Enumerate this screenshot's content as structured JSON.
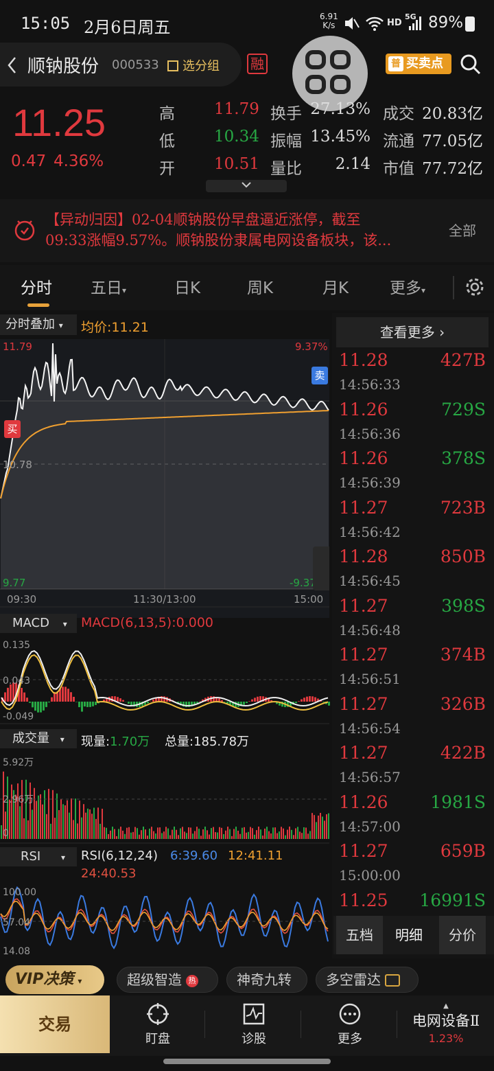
{
  "status": {
    "time": "15:05",
    "date": "2月6日周五",
    "net_speed": "6.91",
    "net_unit": "K/s",
    "hd": "HD",
    "sig": "5G",
    "battery": "89%"
  },
  "header": {
    "title": "顺钠股份",
    "code": "000533",
    "group_label": "选分组",
    "rong": "融",
    "buy_sell": "买卖点"
  },
  "quote": {
    "price": "11.25",
    "change": "0.47",
    "pct": "4.36%",
    "rows": [
      {
        "k1": "高",
        "v1": "11.79",
        "k2": "换手",
        "v2": "27.13%",
        "k3": "成交",
        "v3": "20.83亿"
      },
      {
        "k1": "低",
        "v1": "10.34",
        "k2": "振幅",
        "v2": "13.45%",
        "k3": "流通",
        "v3": "77.05亿"
      },
      {
        "k1": "开",
        "v1": "10.51",
        "k2": "量比",
        "v2": "2.14",
        "k3": "市值",
        "v3": "77.72亿"
      }
    ]
  },
  "news": {
    "line1": "【异动归因】02-04顺钠股份早盘逼近涨停，截至",
    "line2": "09:33涨幅9.57%。顺钠股份隶属电网设备板块，该...",
    "all": "全部"
  },
  "tabs": [
    "分时",
    "五日",
    "日K",
    "周K",
    "月K",
    "更多"
  ],
  "chart": {
    "overlay": "分时叠加",
    "avg": "均价:11.21",
    "high": "11.79",
    "high_pct": "9.37%",
    "mid": "10.78",
    "low": "9.77",
    "low_pct": "-9.37%",
    "buy": "买",
    "sell": "卖",
    "t0": "09:30",
    "t1": "11:30/13:00",
    "t2": "15:00"
  },
  "macd": {
    "label": "MACD",
    "value": "MACD(6,13,5):0.000",
    "y1": "0.135",
    "y2": "0.043",
    "y3": "-0.049"
  },
  "vol": {
    "label": "成交量",
    "now_label": "现量:",
    "now": "1.70万",
    "total": "总量:185.78万",
    "y1": "5.92万",
    "y2": "2.96万",
    "y3": "0"
  },
  "rsi": {
    "label": "RSI",
    "v0": "RSI(6,12,24)",
    "v1": "6:39.60",
    "v2": "12:41.11",
    "v3": "24:40.53",
    "y1": "100.00",
    "y2": "57.04",
    "y3": "14.08"
  },
  "ticks": {
    "more": "查看更多 ›",
    "rows": [
      {
        "p": "11.28",
        "v": "427B",
        "t": "14:56:33",
        "pc": "red",
        "vc": "red"
      },
      {
        "p": "11.26",
        "v": "729S",
        "t": "14:56:36",
        "pc": "red",
        "vc": "green"
      },
      {
        "p": "11.26",
        "v": "378S",
        "t": "14:56:39",
        "pc": "red",
        "vc": "green"
      },
      {
        "p": "11.27",
        "v": "723B",
        "t": "14:56:42",
        "pc": "red",
        "vc": "red"
      },
      {
        "p": "11.28",
        "v": "850B",
        "t": "14:56:45",
        "pc": "red",
        "vc": "red"
      },
      {
        "p": "11.27",
        "v": "398S",
        "t": "14:56:48",
        "pc": "red",
        "vc": "green"
      },
      {
        "p": "11.27",
        "v": "374B",
        "t": "14:56:51",
        "pc": "red",
        "vc": "red"
      },
      {
        "p": "11.27",
        "v": "326B",
        "t": "14:56:54",
        "pc": "red",
        "vc": "red"
      },
      {
        "p": "11.27",
        "v": "422B",
        "t": "14:56:57",
        "pc": "red",
        "vc": "red"
      },
      {
        "p": "11.26",
        "v": "1981S",
        "t": "14:57:00",
        "pc": "red",
        "vc": "green"
      },
      {
        "p": "11.27",
        "v": "659B",
        "t": "15:00:00",
        "pc": "red",
        "vc": "red"
      },
      {
        "p": "11.25",
        "v": "16991S",
        "t": "",
        "pc": "red",
        "vc": "green"
      }
    ],
    "tabs": [
      "五档",
      "明细",
      "分价"
    ]
  },
  "features": {
    "vip": "VIP决策",
    "items": [
      "超级智造",
      "神奇九转",
      "多空雷达"
    ],
    "hot": "热"
  },
  "nav": {
    "trade": "交易",
    "items": [
      "盯盘",
      "诊股",
      "更多"
    ],
    "sector": "电网设备Ⅱ",
    "sector_pct": "1.23%"
  },
  "colors": {
    "up": "#e0393e",
    "down": "#27a844",
    "avg": "#f0a030",
    "bg": "#121212"
  }
}
